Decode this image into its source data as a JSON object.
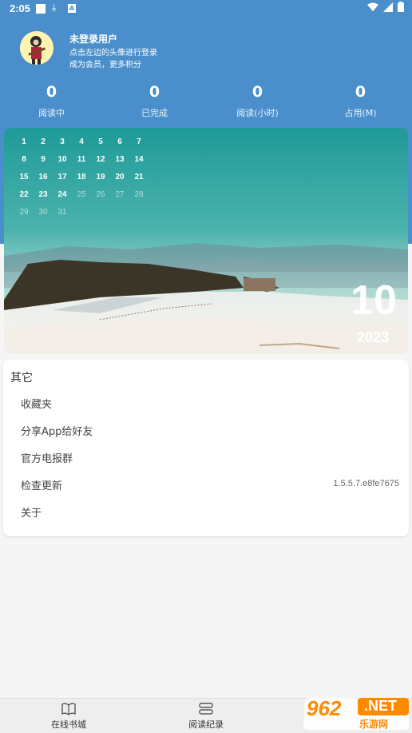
{
  "status_bar": {
    "time": "2:05"
  },
  "profile": {
    "username": "未登录用户",
    "hint_login": "点击左边的头像进行登录",
    "hint_member": "成为会员，更多积分"
  },
  "stats": [
    {
      "value": "0",
      "label": "阅读中"
    },
    {
      "value": "0",
      "label": "已完成"
    },
    {
      "value": "0",
      "label": "阅读(小时)"
    },
    {
      "value": "0",
      "label": "占用(M)"
    }
  ],
  "calendar": {
    "days": [
      "1",
      "2",
      "3",
      "4",
      "5",
      "6",
      "7",
      "8",
      "9",
      "10",
      "11",
      "12",
      "13",
      "14",
      "15",
      "16",
      "17",
      "18",
      "19",
      "20",
      "21",
      "22",
      "23",
      "24",
      "25",
      "26",
      "27",
      "28",
      "29",
      "30",
      "31"
    ],
    "highlighted_through": 24,
    "month": "10",
    "year": "2023"
  },
  "other_section": {
    "title": "其它",
    "items": [
      {
        "label": "收藏夹",
        "value": ""
      },
      {
        "label": "分享App给好友",
        "value": ""
      },
      {
        "label": "官方电报群",
        "value": ""
      },
      {
        "label": "检查更新",
        "value": "1.5.5.7.e8fe7675"
      },
      {
        "label": "关于",
        "value": ""
      }
    ]
  },
  "bottom_nav": [
    {
      "label": "在线书城",
      "icon": "book-open-icon"
    },
    {
      "label": "阅读纪录",
      "icon": "stack-icon"
    }
  ],
  "watermark": {
    "number": "962",
    "net": ".NET",
    "text": "乐游网"
  },
  "colors": {
    "header": "#4a8fcb",
    "accent": "#ff8a00"
  }
}
